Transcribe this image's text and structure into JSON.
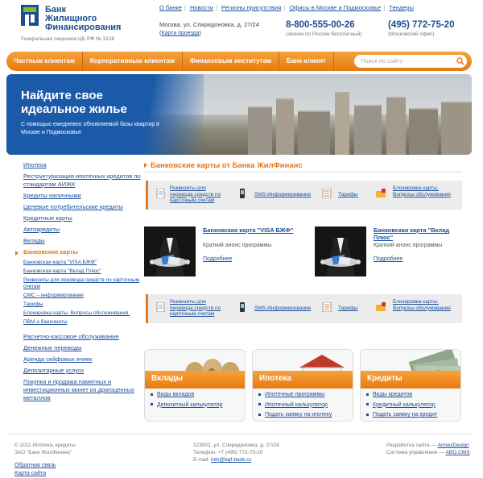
{
  "brand": {
    "name_1": "Банк",
    "name_2": "Жилищного",
    "name_3": "Финансирования",
    "license": "Генеральная лицензия ЦБ РФ № 3138",
    "accent": "#e4781b",
    "blue": "#1d4e8c"
  },
  "topnav": [
    "О банке",
    "Новости",
    "Регионы присутствия",
    "Офисы в Москве и Подмосковье",
    "Тендеры"
  ],
  "address": {
    "text": "Москва, ул. Спиридоновка, д. 27/24",
    "map_link": "Карта проезда"
  },
  "phones": [
    {
      "number": "8-800-555-00-26",
      "caption": "(звонок по России бесплатный)"
    },
    {
      "number": "(495) 772-75-20",
      "caption": "(Московский офис)"
    }
  ],
  "menu": [
    "Частным клиентам",
    "Корпоративным клиентам",
    "Финансовым институтам",
    "Банк-клиент"
  ],
  "search": {
    "placeholder": "Поиск по сайту"
  },
  "banner": {
    "line1": "Найдите свое",
    "line2": "идеальное жилье",
    "sub": "С помощью ежедневно обновляемой базы квартир в Москве и Подмосковье"
  },
  "sidebar": {
    "top": [
      "Ипотека",
      "Реструктуризация ипотечных кредитов по стандартам АИЖК",
      "Кредиты наличными",
      "Целевые потребительские кредиты",
      "Кредитные карты",
      "Автокредиты",
      "Вклады"
    ],
    "active": "Банковские карты",
    "sub": [
      "Банковская карта \"VISA БЖФ\"",
      "Банковская карта \"Вклад Плюс\"",
      "Реквизиты для перевода средств по карточным счетам",
      "СМС – информирование",
      "Тарифы",
      "Блокировка карты. Вопросы обслуживания.",
      "ПВМ и банкоматы"
    ],
    "bottom": [
      "Расчетно-кассовое обслуживание",
      "Денежные переводы",
      "Аренда сейфовых ячеек",
      "Депозитарные услуги",
      "Покупка и продажа памятных и инвестиционных монет из драгоценных металлов"
    ]
  },
  "main": {
    "title": "Банковские карты от Банка ЖилФинанс",
    "actions": [
      {
        "label": "Реквизиты для перевода средств по карточным счетам",
        "icon": "document-icon"
      },
      {
        "label": "SMS-Информирование",
        "icon": "phone-icon"
      },
      {
        "label": "Тарифы",
        "icon": "list-icon"
      },
      {
        "label": "Блокировка карты. Вопросы обслуживания",
        "icon": "lock-card-icon"
      }
    ],
    "cards": [
      {
        "title": "Банковская карта \"VISA БЖФ\"",
        "desc": "Краткий анонс программы",
        "more": "Подробнее"
      },
      {
        "title": "Банковская карта \"Вклад Плюс\"",
        "desc": "Краткий анонс программы",
        "more": "Подробнее"
      }
    ],
    "tiles": [
      {
        "label": "Вклады",
        "links": [
          "Виды вкладов",
          "Депозитный калькулятор"
        ]
      },
      {
        "label": "Ипотека",
        "links": [
          "Ипотечные программы",
          "Ипотечный калькулятор",
          "Подать заявку на ипотеку"
        ]
      },
      {
        "label": "Кредиты",
        "links": [
          "Виды кредитов",
          "Кредитный калькулятор",
          "Подать заявку на кредит"
        ]
      }
    ]
  },
  "footer": {
    "copyright": "© 2011 Ипотека, кредиты",
    "company": "ЗАО \"Банк ЖилФинанс\"",
    "address": "123001, ул. Спиридоновка, д. 27/24",
    "phone": "Телефон: +7 (495) 772-75-20",
    "email_label": "E-mail:",
    "email": "info@bgf-bank.ru",
    "dev_label": "Разработка сайта —",
    "dev": "ArmexDesign",
    "cms_label": "Система управления —",
    "cms": "ABO.CMS",
    "feedback": "Обратная связь",
    "sitemap": "Карта сайта"
  }
}
